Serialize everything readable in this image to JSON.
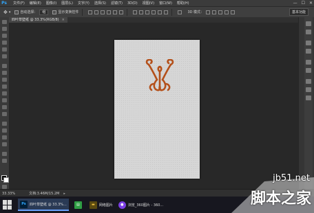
{
  "app": {
    "logo": "Ps",
    "menu": [
      "文件(F)",
      "编辑(E)",
      "图像(I)",
      "图层(L)",
      "文字(Y)",
      "选择(S)",
      "滤镜(T)",
      "3D(D)",
      "视图(V)",
      "窗口(W)",
      "帮助(H)"
    ],
    "window_controls": [
      "—",
      "☐",
      "✕"
    ]
  },
  "options_bar": {
    "auto_select_label": "自动选择：",
    "auto_select_value": "组",
    "show_transform_label": "显示变换控件",
    "mode_3d_label": "3D 模式：",
    "workspace": "基本功能"
  },
  "document": {
    "tab_title": "四叶草壁纸 @ 33.3%(RGB/8)",
    "tab_close": "×",
    "zoom": "33.33%",
    "doc_info": "文档:3.46M/15.2M",
    "status_arrow": "▸"
  },
  "taskbar": {
    "items": [
      {
        "badge": "Ps",
        "label": "四叶草壁纸 @ 33.3%...",
        "color": "#31a8ff",
        "bg": "#001e36"
      },
      {
        "badge": "▤",
        "label": "",
        "color": "#ffffff",
        "bg": "#2f9e44"
      },
      {
        "badge": "▬",
        "label": "网络图片",
        "color": "#f5c542",
        "bg": "#5a4a10"
      },
      {
        "badge": "●",
        "label": "浏览_360图片 - 360...",
        "color": "#ffffff",
        "bg": "#7b3fe4"
      }
    ]
  },
  "watermark": {
    "url": "jb51.net",
    "text": "脚本之家"
  },
  "colors": {
    "ornament": "#b4501a",
    "canvas": "#d6d6d6",
    "accent": "#31a8ff"
  }
}
